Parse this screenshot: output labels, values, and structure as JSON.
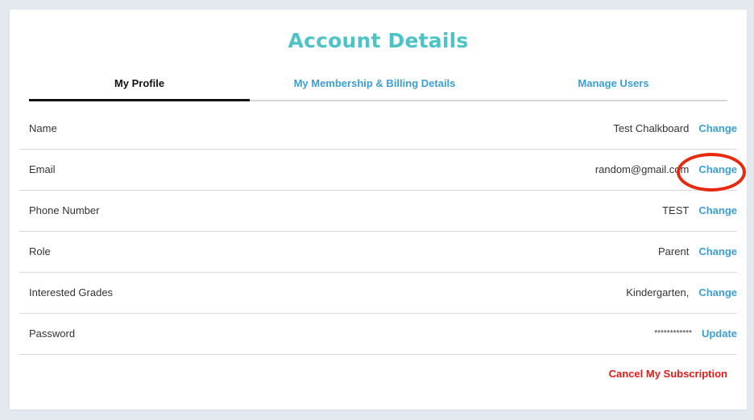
{
  "page": {
    "title": "Account Details"
  },
  "tabs": [
    {
      "label": "My Profile",
      "active": true
    },
    {
      "label": "My Membership & Billing Details",
      "active": false
    },
    {
      "label": "Manage Users",
      "active": false
    }
  ],
  "profile": {
    "rows": [
      {
        "label": "Name",
        "value": "Test Chalkboard",
        "action": "Change"
      },
      {
        "label": "Email",
        "value": "random@gmail.com",
        "action": "Change"
      },
      {
        "label": "Phone Number",
        "value": "TEST",
        "action": "Change"
      },
      {
        "label": "Role",
        "value": "Parent",
        "action": "Change"
      },
      {
        "label": "Interested Grades",
        "value": "Kindergarten,",
        "action": "Change"
      },
      {
        "label": "Password",
        "value": "************",
        "action": "Update"
      }
    ]
  },
  "footer": {
    "cancel_label": "Cancel My Subscription"
  },
  "colors": {
    "title": "#4ec3c6",
    "link": "#3b9fd3",
    "danger": "#e41b17",
    "annotation": "#e8290e"
  }
}
